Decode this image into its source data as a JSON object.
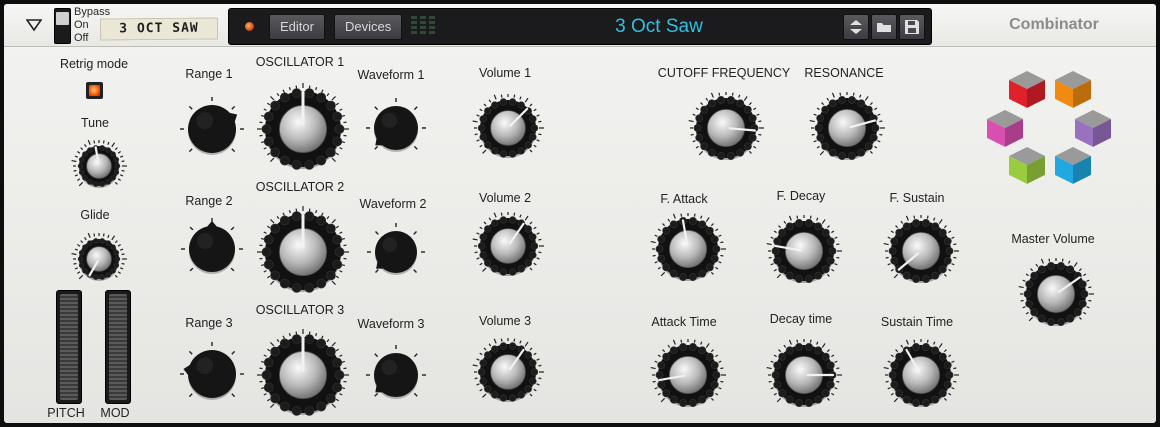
{
  "header": {
    "bypass_label": "Bypass",
    "on_label": "On",
    "off_label": "Off",
    "patch_tape": "3 OCT SAW",
    "editor_button": "Editor",
    "devices_button": "Devices",
    "patch_name": "3 Oct Saw",
    "device_name": "Combinator"
  },
  "left": {
    "retrig_label": "Retrig mode",
    "tune_label": "Tune",
    "glide_label": "Glide",
    "pitch_label": "PITCH",
    "mod_label": "MOD"
  },
  "oscillators": [
    {
      "title": "OSCILLATOR 1",
      "range_label": "Range 1",
      "waveform_label": "Waveform 1",
      "volume_label": "Volume 1"
    },
    {
      "title": "OSCILLATOR  2",
      "range_label": "Range 2",
      "waveform_label": "Waveform 2",
      "volume_label": "Volume 2"
    },
    {
      "title": "OSCILLATOR 3",
      "range_label": "Range 3",
      "waveform_label": "Waveform 3",
      "volume_label": "Volume 3"
    }
  ],
  "filter": {
    "cutoff_label": "CUTOFF FREQUENCY",
    "resonance_label": "RESONANCE",
    "f_attack_label": "F. Attack",
    "f_decay_label": "F. Decay",
    "f_sustain_label": "F. Sustain",
    "attack_time_label": "Attack Time",
    "decay_time_label": "Decay time",
    "sustain_time_label": "Sustain Time"
  },
  "master": {
    "volume_label": "Master Volume"
  },
  "colors": {
    "accent_blue": "#32c0e0",
    "led_orange": "#ff5a10",
    "cube_red": "#e0202a",
    "cube_orange": "#f08a10",
    "cube_pink": "#d84fb0",
    "cube_purple": "#9a70c0",
    "cube_green": "#9acc40",
    "cube_blue": "#20a8e0"
  }
}
